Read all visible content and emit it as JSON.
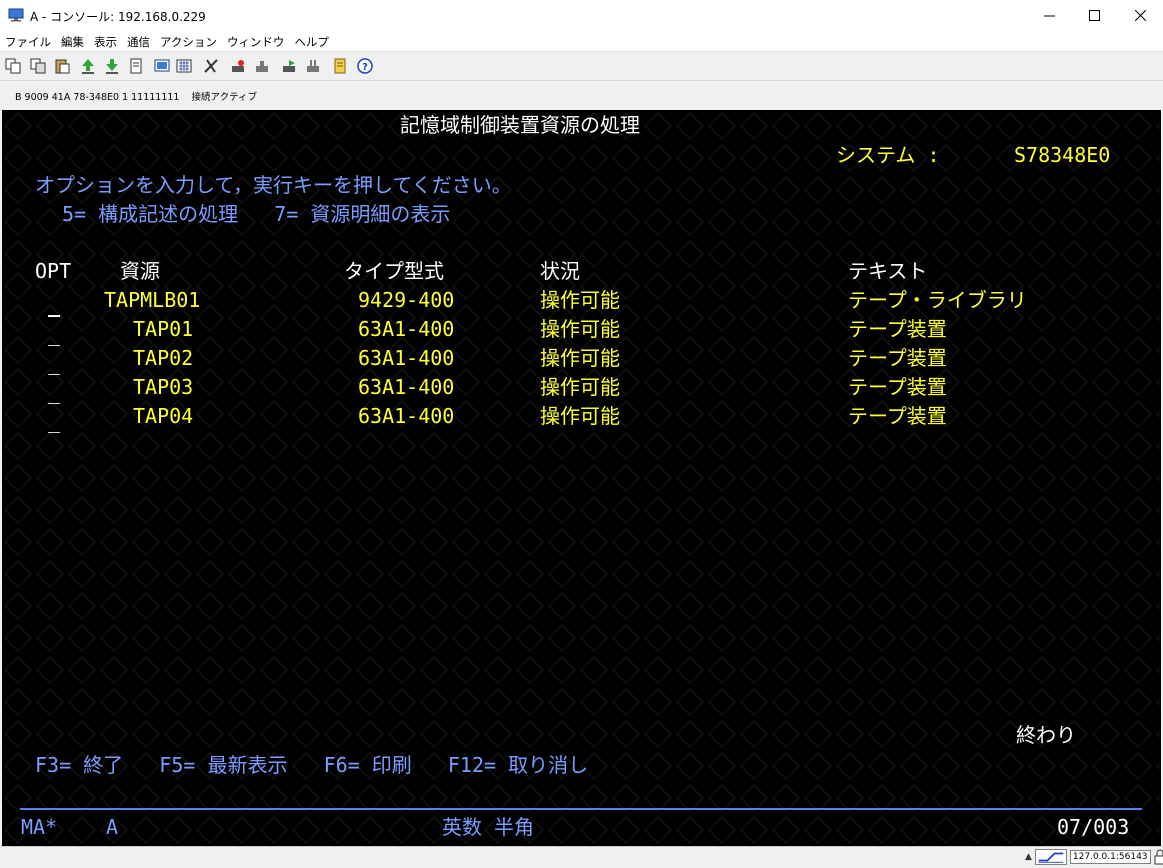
{
  "window": {
    "title": "A - コンソール: 192.168.0.229"
  },
  "menu": {
    "items": [
      "ファイル",
      "編集",
      "表示",
      "通信",
      "アクション",
      "ウィンドウ",
      "ヘルプ"
    ]
  },
  "status_strip": {
    "text": "B 9009 41A 78-348E0 1 11111111    接続アクティブ"
  },
  "screen": {
    "title": "記憶域制御装置資源の処理",
    "system_label": "システム :",
    "system_value": "S78348E0",
    "instruction": "オプションを入力して，実行キーを押してください。",
    "options": "5= 構成記述の処理   7= 資源明細の表示",
    "headers": {
      "opt": "OPT",
      "resource": "資源",
      "type": "タイプ型式",
      "status": "状況",
      "text": "テキスト"
    },
    "rows": [
      {
        "opt": "_",
        "resource": "TAPMLB01",
        "type": "9429-400",
        "status": "操作可能",
        "text": "テープ・ライブラリ"
      },
      {
        "opt": "_",
        "resource": "TAP01",
        "type": "63A1-400",
        "status": "操作可能",
        "text": "テープ装置"
      },
      {
        "opt": "_",
        "resource": "TAP02",
        "type": "63A1-400",
        "status": "操作可能",
        "text": "テープ装置"
      },
      {
        "opt": "_",
        "resource": "TAP03",
        "type": "63A1-400",
        "status": "操作可能",
        "text": "テープ装置"
      },
      {
        "opt": "_",
        "resource": "TAP04",
        "type": "63A1-400",
        "status": "操作可能",
        "text": "テープ装置"
      }
    ],
    "bottom_label": "終わり",
    "function_keys": "F3= 終了   F5= 最新表示   F6= 印刷   F12= 取り消し",
    "oia": {
      "left": "MA*",
      "mode": "A",
      "input": "英数 半角",
      "cursor": "07/003"
    }
  },
  "tray": {
    "address": "127.0.0.1:56143"
  },
  "colors": {
    "terminal_bg": "#000000",
    "white_text": "#ffffff",
    "yellow_text": "#ffff33",
    "blue_text": "#7b9cff"
  }
}
